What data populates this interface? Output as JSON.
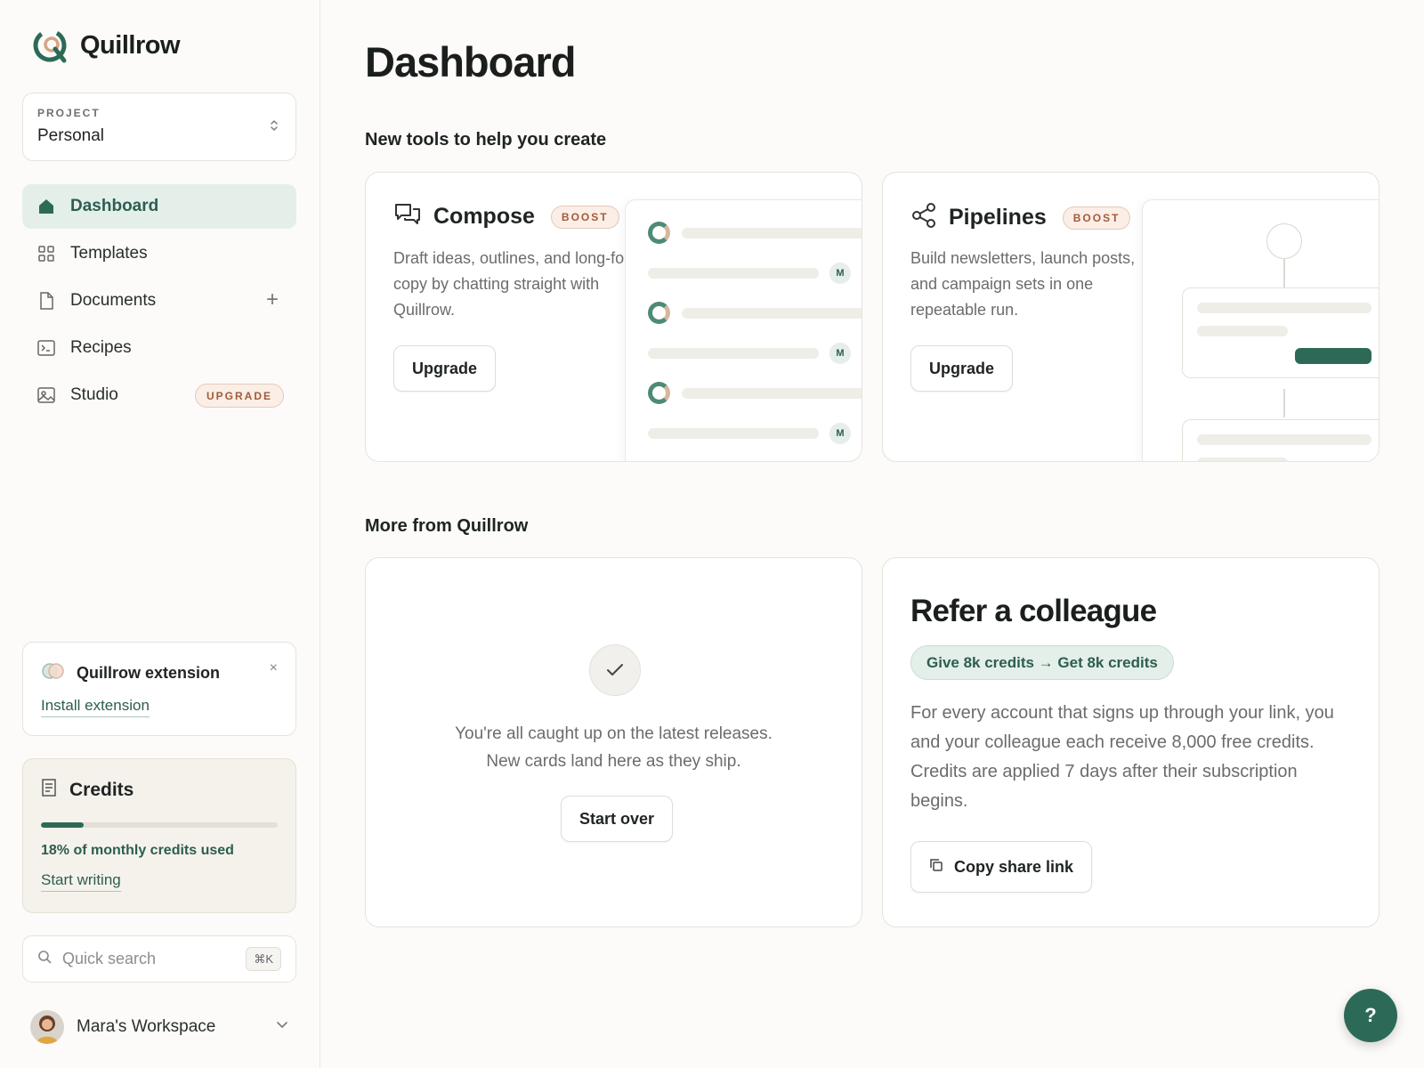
{
  "brand": {
    "name": "Quillrow"
  },
  "project": {
    "label": "PROJECT",
    "value": "Personal"
  },
  "nav": {
    "items": [
      {
        "label": "Dashboard",
        "icon": "home-icon",
        "active": true
      },
      {
        "label": "Templates",
        "icon": "grid-icon"
      },
      {
        "label": "Documents",
        "icon": "document-icon",
        "action": "+"
      },
      {
        "label": "Recipes",
        "icon": "terminal-icon"
      },
      {
        "label": "Studio",
        "icon": "image-icon",
        "badge": "UPGRADE"
      }
    ]
  },
  "extension": {
    "title": "Quillrow extension",
    "close": "×",
    "link": "Install extension"
  },
  "credits": {
    "title": "Credits",
    "used_percent": 18,
    "usage_text": "18% of monthly credits used",
    "link": "Start writing"
  },
  "search": {
    "placeholder": "Quick search",
    "shortcut": "⌘K"
  },
  "workspace": {
    "name": "Mara's Workspace"
  },
  "main": {
    "title": "Dashboard",
    "tools_section": "New tools to help you create",
    "tools": [
      {
        "name": "Compose",
        "badge": "BOOST",
        "description": "Draft ideas, outlines, and long-form copy by chatting straight with Quillrow.",
        "button": "Upgrade",
        "mock_badge": "M"
      },
      {
        "name": "Pipelines",
        "badge": "BOOST",
        "description": "Build newsletters, launch posts, and campaign sets in one repeatable run.",
        "button": "Upgrade"
      }
    ],
    "more_section": "More from Quillrow",
    "caught_up": {
      "line1": "You're all caught up on the latest releases.",
      "line2": "New cards land here as they ship.",
      "button": "Start over"
    },
    "refer": {
      "title": "Refer a colleague",
      "pill": "Give 8k credits → Get 8k credits",
      "description": "For every account that signs up through your link, you and your colleague each receive 8,000 free credits. Credits are applied 7 days after their subscription begins.",
      "button": "Copy share link"
    }
  },
  "help": {
    "label": "?"
  },
  "colors": {
    "accent": "#2c6a57",
    "accent_light": "#e4efea",
    "badge_bg": "#fbeee6",
    "badge_text": "#a35a3a"
  }
}
